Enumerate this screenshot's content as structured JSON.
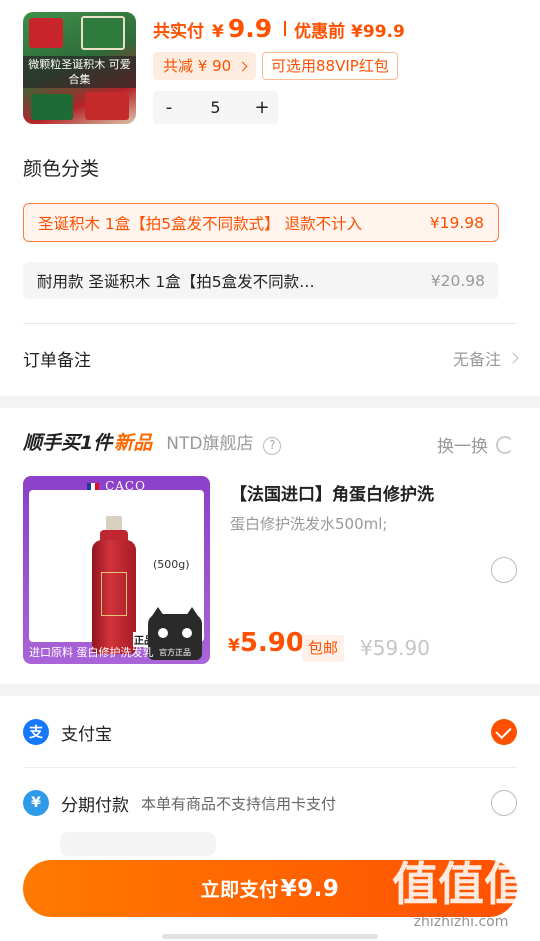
{
  "product": {
    "thumb_caption": "微颗粒圣诞积木 可爱合集",
    "total_label": "共实付",
    "currency": "¥",
    "total_amount": "9.9",
    "pre_discount_label": "优惠前 ¥99.9",
    "discount_badge": "共减 ¥ 90",
    "vip_badge": "可选用88VIP红包",
    "quantity": "5",
    "minus": "-",
    "plus": "+"
  },
  "color_section": {
    "title": "颜色分类",
    "options": [
      {
        "name": "圣诞积木 1盒【拍5盒发不同款式】 退款不计入",
        "price": "¥19.98",
        "selected": true
      },
      {
        "name": "耐用款 圣诞积木 1盒【拍5盒发不同款…",
        "price": "¥20.98",
        "selected": false
      }
    ]
  },
  "remark": {
    "label": "订单备注",
    "value": "无备注"
  },
  "addon": {
    "title_main": "顺手买1件",
    "title_new": "新品",
    "shop": "NTD旗舰店",
    "help": "?",
    "swap_label": "换一换",
    "image_brand": "CACO",
    "image_weight": "(500g)",
    "image_caption": "进口原料 蛋白修护洗发乳",
    "image_genuine": "正品",
    "image_official": "官方正品",
    "name": "【法国进口】角蛋白修护洗",
    "desc": "蛋白修护洗发水500ml;",
    "price_currency": "¥",
    "price": "5.90",
    "ship_badge": "包邮",
    "original_price": "¥59.90"
  },
  "payment": {
    "alipay": {
      "icon_char": "支",
      "label": "支付宝",
      "selected": true
    },
    "installment": {
      "icon_char": "¥",
      "label": "分期付款",
      "note": "本单有商品不支持信用卡支付",
      "selected": false
    }
  },
  "pay_button": {
    "label": "立即支付",
    "amount": "¥9.9"
  },
  "watermark": {
    "big": "值值值",
    "small": "zhizhizhi.com"
  },
  "colors": {
    "accent": "#ff5000",
    "alipay_blue": "#1677ff",
    "installment_blue": "#2f9be8"
  }
}
